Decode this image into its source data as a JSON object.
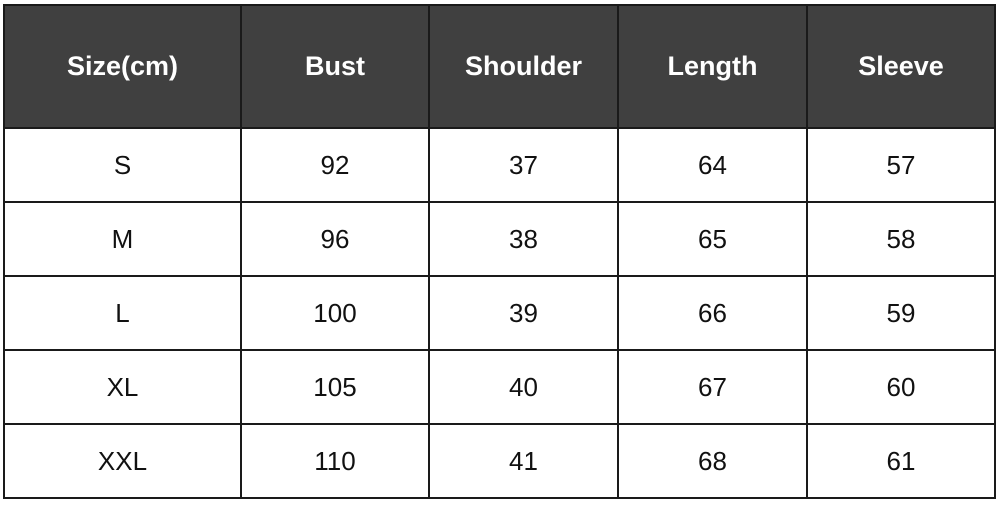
{
  "table": {
    "headers": [
      "Size(cm)",
      "Bust",
      "Shoulder",
      "Length",
      "Sleeve"
    ],
    "rows": [
      [
        "S",
        "92",
        "37",
        "64",
        "57"
      ],
      [
        "M",
        "96",
        "38",
        "65",
        "58"
      ],
      [
        "L",
        "100",
        "39",
        "66",
        "59"
      ],
      [
        "XL",
        "105",
        "40",
        "67",
        "60"
      ],
      [
        "XXL",
        "110",
        "41",
        "68",
        "61"
      ]
    ],
    "header_bg": "#404040"
  }
}
